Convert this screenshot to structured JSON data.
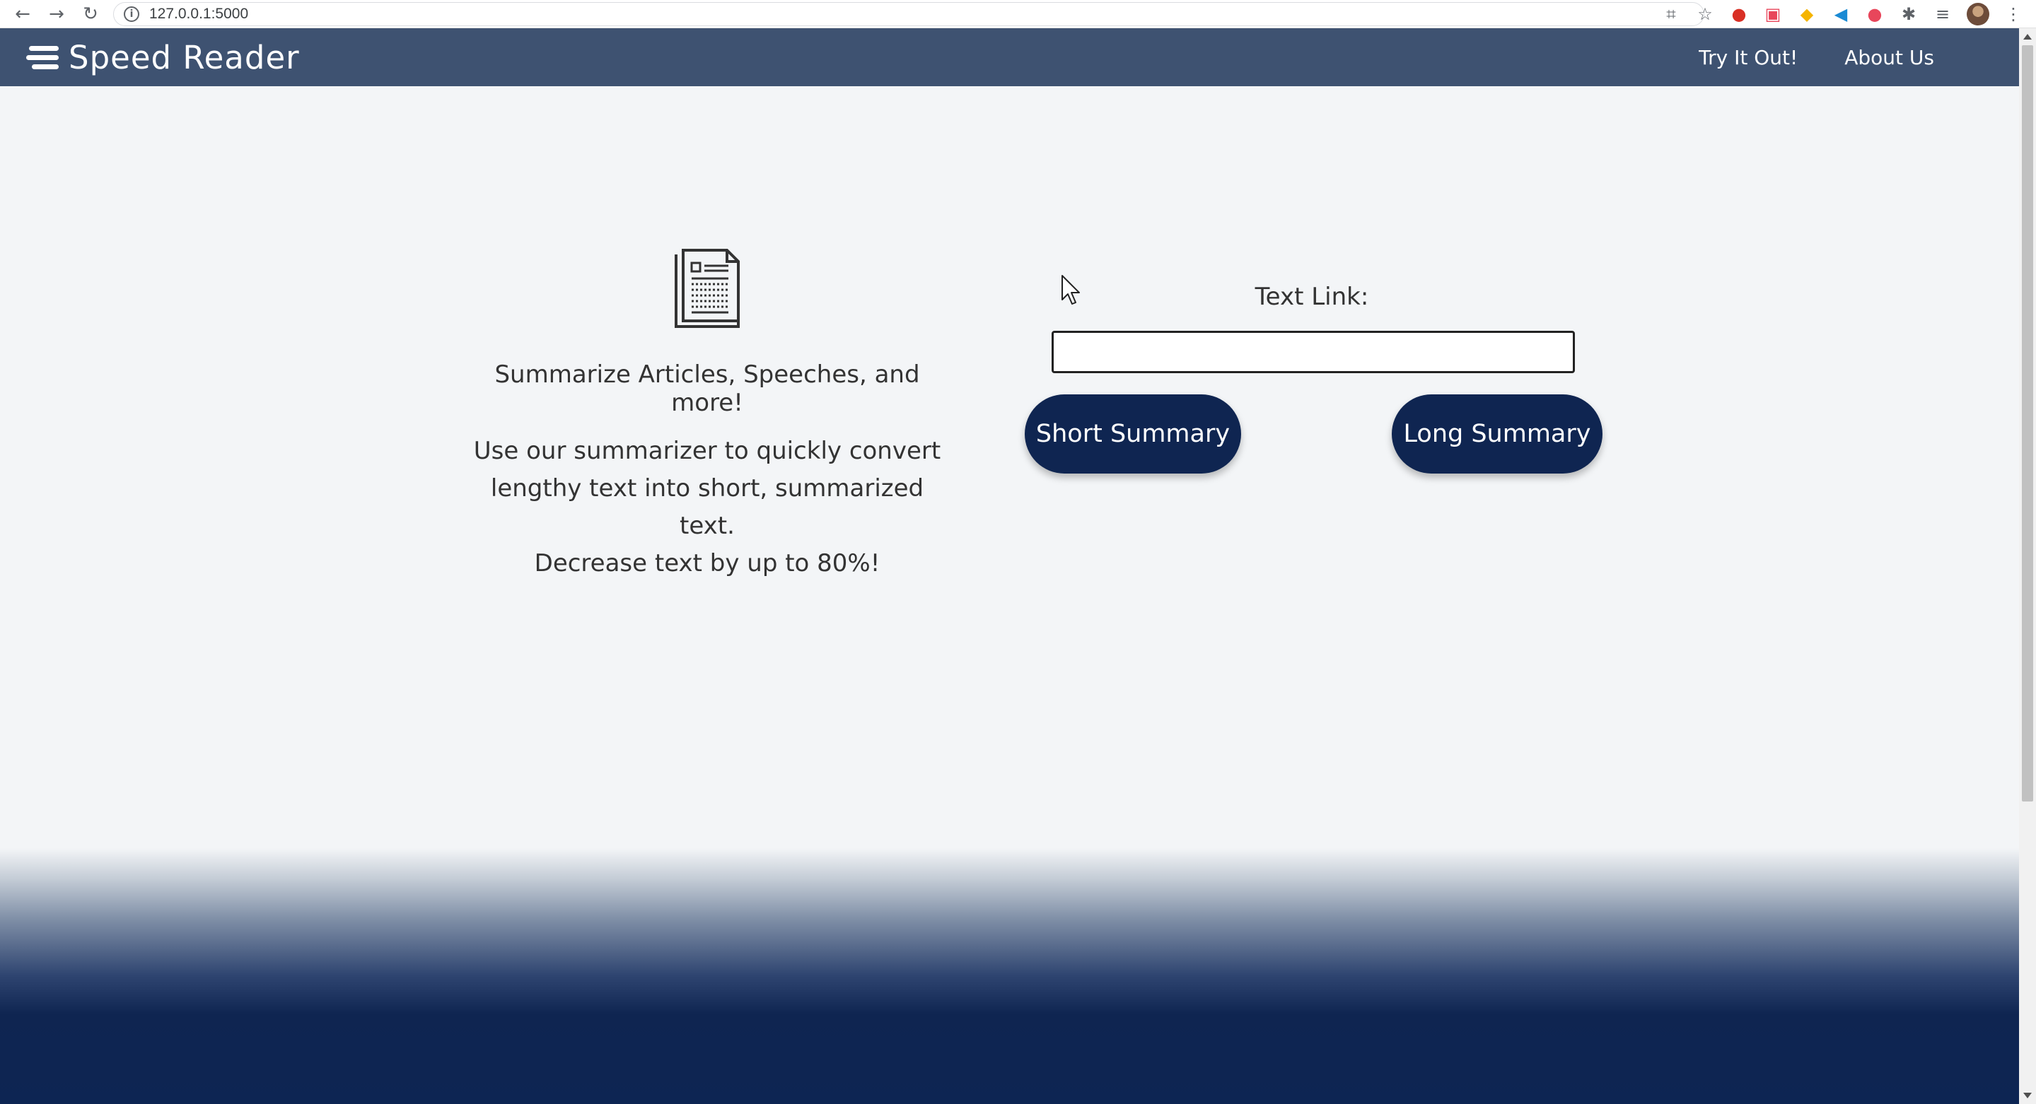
{
  "browser": {
    "url": "127.0.0.1:5000"
  },
  "navbar": {
    "brand": "Speed Reader",
    "links": [
      "Try It Out!",
      "About Us"
    ]
  },
  "hero": {
    "tagline": "Summarize Articles, Speeches, and more!",
    "description_lines": [
      "Use our summarizer to quickly convert",
      "lengthy text into short, summarized text.",
      "Decrease text by up to 80%!"
    ]
  },
  "form": {
    "label": "Text Link:",
    "input_value": "",
    "short_button": "Short Summary",
    "long_button": "Long Summary"
  },
  "colors": {
    "navbar": "#3e5271",
    "button": "#0f2551",
    "footer": "#0d2553",
    "background": "#f3f5f7"
  }
}
